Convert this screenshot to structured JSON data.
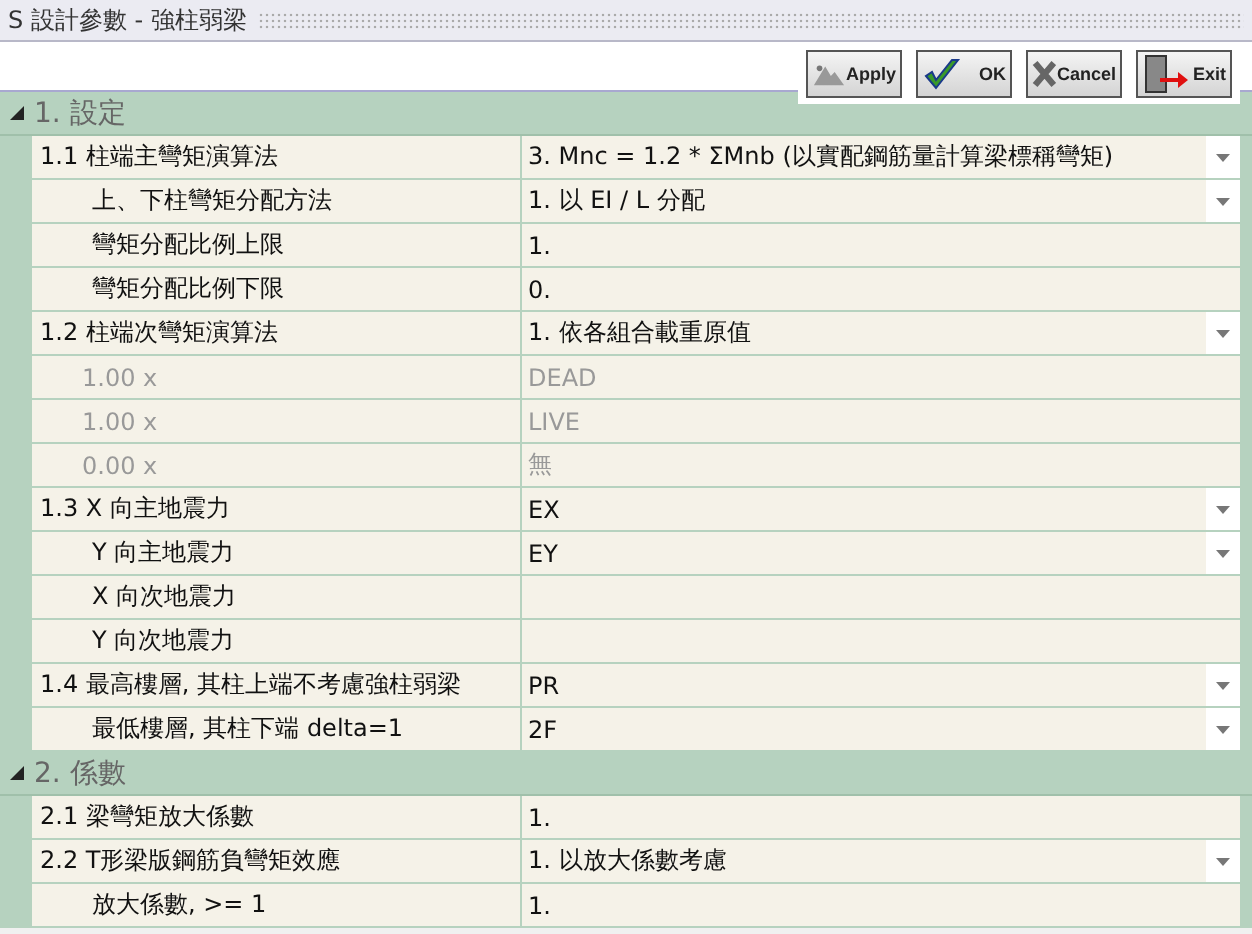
{
  "window": {
    "title": "S 設計參數 - 強柱弱梁"
  },
  "toolbar": {
    "buttons": [
      {
        "kind": "apply",
        "label": "Apply"
      },
      {
        "kind": "ok",
        "label": "OK"
      },
      {
        "kind": "cancel",
        "label": "Cancel"
      },
      {
        "kind": "exit",
        "label": "Exit"
      }
    ]
  },
  "sections": [
    {
      "title": "1. 設定",
      "expanded": true,
      "rows": [
        {
          "label": "1.1 柱端主彎矩演算法",
          "value": "3. Mnc = 1.2 * ΣMnb (以實配鋼筋量計算梁標稱彎矩)",
          "dropdown": true,
          "disabled": false,
          "children": [
            {
              "label": "上、下柱彎矩分配方法",
              "value": "1. 以 EI / L 分配",
              "dropdown": true,
              "disabled": false
            },
            {
              "label": "彎矩分配比例上限",
              "value": "1.",
              "dropdown": false,
              "disabled": false
            },
            {
              "label": "彎矩分配比例下限",
              "value": "0.",
              "dropdown": false,
              "disabled": false
            }
          ]
        },
        {
          "label": "1.2 柱端次彎矩演算法",
          "value": "1. 依各組合載重原值",
          "dropdown": true,
          "disabled": false,
          "children": [
            {
              "label": "1.00 x",
              "value": "DEAD",
              "dropdown": false,
              "disabled": true
            },
            {
              "label": "1.00 x",
              "value": "LIVE",
              "dropdown": false,
              "disabled": true
            },
            {
              "label": "0.00 x",
              "value": "無",
              "dropdown": false,
              "disabled": true
            }
          ]
        },
        {
          "label": "1.3 X 向主地震力",
          "value": "EX",
          "dropdown": true,
          "disabled": false,
          "children": [
            {
              "label": "Y 向主地震力",
              "value": "EY",
              "dropdown": true,
              "disabled": false
            },
            {
              "label": "X 向次地震力",
              "dropdown": false,
              "disabled": false
            },
            {
              "label": "Y 向次地震力",
              "dropdown": false,
              "disabled": false
            }
          ]
        },
        {
          "label": "1.4 最高樓層, 其柱上端不考慮強柱弱梁",
          "value": "PR",
          "dropdown": true,
          "disabled": false,
          "children": [
            {
              "label": "最低樓層, 其柱下端 delta=1",
              "value": "2F",
              "dropdown": true,
              "disabled": false
            }
          ]
        }
      ]
    },
    {
      "title": "2. 係數",
      "expanded": true,
      "rows": [
        {
          "label": "2.1 梁彎矩放大係數",
          "value": "1.",
          "dropdown": false,
          "disabled": false
        },
        {
          "label": "2.2 T形梁版鋼筋負彎矩效應",
          "value": "1. 以放大係數考慮",
          "dropdown": true,
          "disabled": false,
          "children": [
            {
              "label": "放大係數, >= 1",
              "value": "1.",
              "dropdown": false,
              "disabled": false
            }
          ]
        }
      ]
    }
  ]
}
